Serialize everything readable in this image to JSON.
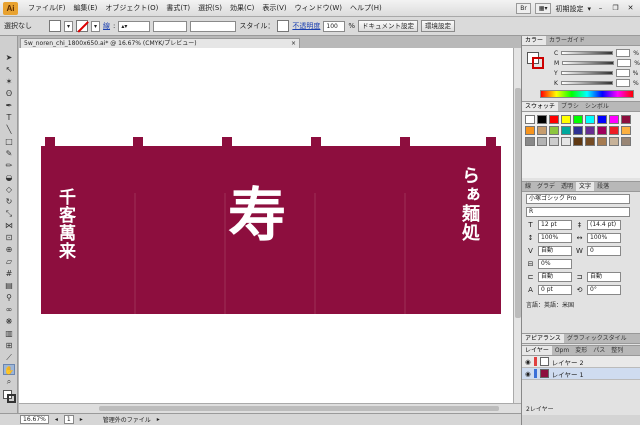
{
  "app": {
    "logo": "Ai",
    "menu": [
      "ファイル(F)",
      "編集(E)",
      "オブジェクト(O)",
      "書式(T)",
      "選択(S)",
      "効果(C)",
      "表示(V)",
      "ウィンドウ(W)",
      "ヘルプ(H)"
    ],
    "workspace": "初期設定"
  },
  "controlbar": {
    "selection_label": "選択なし",
    "stroke_label": "線",
    "style_label": "スタイル：",
    "opacity_label": "不透明度",
    "opacity_value": "100",
    "opacity_unit": "%",
    "document_setup_button": "ドキュメント設定",
    "preferences_button": "環境設定"
  },
  "document": {
    "tab_title": "5w_noren_chi_1800x650.ai* @ 16.67% (CMYK/プレビュー)",
    "close": "×"
  },
  "artwork": {
    "noren_color": "#8d0e3e",
    "left_text": "千客萬来",
    "center_text": "寿",
    "right_text": "らぁ麺処"
  },
  "statusbar": {
    "zoom": "16.67%",
    "artboard": "1",
    "status_text": "管理外のファイル"
  },
  "panels": {
    "color": {
      "tabs": [
        "カラー",
        "カラーガイド"
      ],
      "channels": [
        "C",
        "M",
        "Y",
        "K"
      ],
      "unit": "%"
    },
    "swatches": {
      "tabs": [
        "スウォッチ",
        "ブラシ",
        "シンボル"
      ]
    },
    "character": {
      "tabs": [
        "線",
        "グラデ",
        "透明",
        "文字",
        "段落"
      ],
      "font_family": "小塚ゴシック Pro",
      "font_style": "R",
      "font_size": "12 pt",
      "leading": "(14.4 pt)",
      "vscale": "100%",
      "hscale": "100%",
      "kerning": "自動",
      "tracking": "0",
      "tsume": "0%",
      "mojiaki_1": "自動",
      "mojiaki_2": "自動",
      "baseline": "0 pt",
      "rotation": "0°",
      "language": "言語：英語：米国"
    },
    "appearance": {
      "tabs": [
        "アピアランス",
        "グラフィックスタイル"
      ]
    },
    "layers": {
      "tabs": [
        "レイヤー",
        "Opm",
        "変形",
        "パス",
        "整列"
      ],
      "items": [
        {
          "name": "レイヤー 2",
          "color": "#e04040"
        },
        {
          "name": "レイヤー 1",
          "color": "#3a6fd8"
        }
      ],
      "count": "2レイヤー"
    }
  },
  "colors": {
    "menubar_bg": "#e6e6e6",
    "canvas_bg": "#ffffff",
    "panel_bg": "#d4d4d4"
  }
}
